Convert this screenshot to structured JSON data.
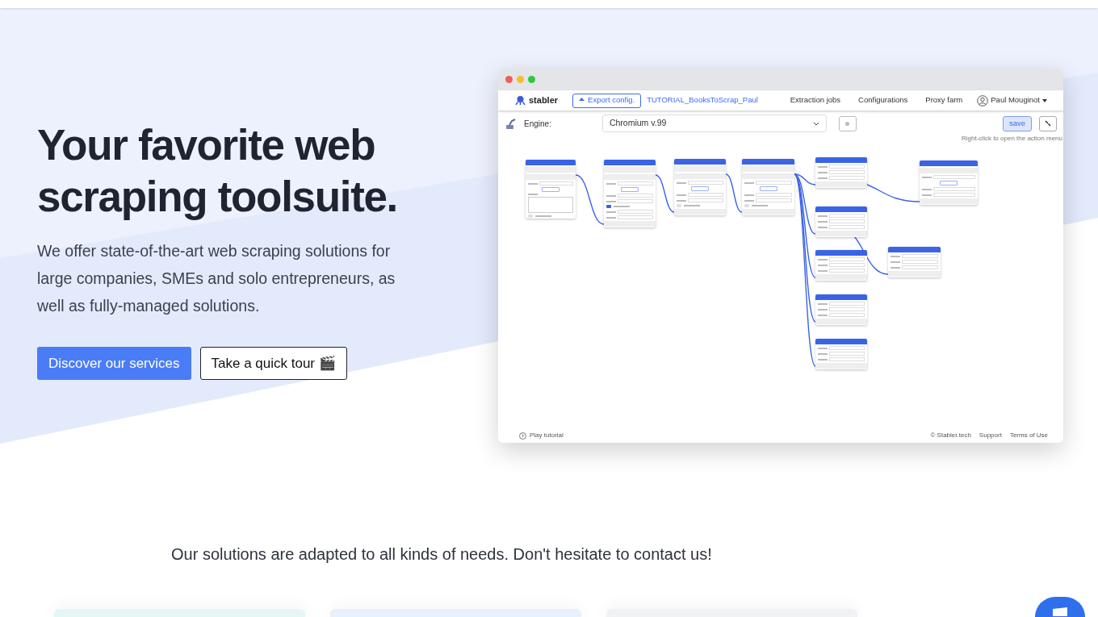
{
  "hero": {
    "title_lines": [
      "Your favorite web",
      "scraping toolsuite."
    ],
    "description": "We offer state-of-the-art web scraping solutions for large companies, SMEs and solo entrepreneurs, as well as fully-managed solutions.",
    "buttons": [
      {
        "label": "Discover our services",
        "kind": "primary"
      },
      {
        "label": "Take a quick tour 🎬",
        "kind": "outline"
      }
    ]
  },
  "app": {
    "brand": "stabler",
    "export_button": "Export config.",
    "config_name": "TUTORIAL_BooksToScrap_Paul",
    "nav": [
      "Extraction jobs",
      "Configurations",
      "Proxy farm"
    ],
    "user": "Paul Mouginot",
    "engine_label": "Engine:",
    "engine_value": "Chromium v.99",
    "save_button": "save",
    "hint": "Right-click to open the action menu",
    "nodes": [
      {
        "rows": [
          {
            "kind": "port"
          },
          {
            "kind": "port"
          },
          {
            "kind": "field"
          },
          {
            "kind": "button"
          },
          {
            "kind": "area"
          },
          {
            "kind": "check",
            "checked": false
          }
        ]
      },
      {
        "rows": [
          {
            "kind": "port"
          },
          {
            "kind": "port"
          },
          {
            "kind": "field"
          },
          {
            "kind": "button"
          },
          {
            "kind": "field"
          },
          {
            "kind": "field"
          },
          {
            "kind": "check",
            "checked": true
          },
          {
            "kind": "field"
          },
          {
            "kind": "field"
          },
          {
            "kind": "port"
          }
        ]
      },
      {
        "rows": [
          {
            "kind": "port"
          },
          {
            "kind": "port"
          },
          {
            "kind": "field"
          },
          {
            "kind": "button"
          },
          {
            "kind": "field"
          },
          {
            "kind": "field"
          },
          {
            "kind": "check",
            "checked": false
          },
          {
            "kind": "port"
          }
        ]
      },
      {
        "rows": [
          {
            "kind": "port"
          },
          {
            "kind": "port"
          },
          {
            "kind": "field"
          },
          {
            "kind": "button"
          },
          {
            "kind": "field"
          },
          {
            "kind": "field"
          },
          {
            "kind": "check",
            "checked": false
          },
          {
            "kind": "port"
          }
        ]
      },
      {
        "rows": [
          {
            "kind": "field"
          },
          {
            "kind": "field"
          },
          {
            "kind": "field"
          },
          {
            "kind": "port"
          }
        ]
      },
      {
        "rows": [
          {
            "kind": "field"
          },
          {
            "kind": "field"
          },
          {
            "kind": "field"
          },
          {
            "kind": "port"
          }
        ]
      },
      {
        "rows": [
          {
            "kind": "field"
          },
          {
            "kind": "field"
          },
          {
            "kind": "field"
          },
          {
            "kind": "port"
          }
        ]
      },
      {
        "rows": [
          {
            "kind": "field"
          },
          {
            "kind": "field"
          },
          {
            "kind": "field"
          },
          {
            "kind": "port"
          }
        ]
      },
      {
        "rows": [
          {
            "kind": "field"
          },
          {
            "kind": "field"
          },
          {
            "kind": "field"
          },
          {
            "kind": "port"
          }
        ]
      },
      {
        "rows": [
          {
            "kind": "field"
          },
          {
            "kind": "field"
          },
          {
            "kind": "field"
          },
          {
            "kind": "port"
          }
        ]
      },
      {
        "rows": [
          {
            "kind": "port"
          },
          {
            "kind": "field"
          },
          {
            "kind": "button"
          },
          {
            "kind": "field"
          },
          {
            "kind": "field"
          },
          {
            "kind": "port"
          }
        ]
      }
    ],
    "footer_left": "Play tutorial",
    "footer_links": [
      "© Stabler.tech",
      "Support",
      "Terms of Use"
    ]
  },
  "tagline": "Our solutions are adapted to all kinds of needs. Don't hesitate to contact us!",
  "cards": [
    {
      "color": "#e6f6f5"
    },
    {
      "color": "#e8effd"
    },
    {
      "color": "#f1f2f4"
    }
  ]
}
